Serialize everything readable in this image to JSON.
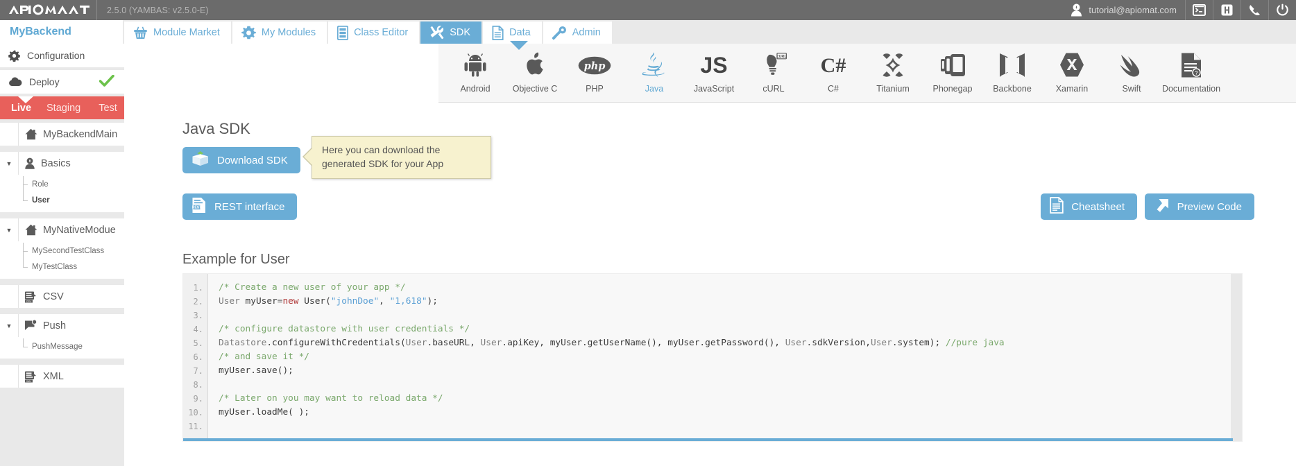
{
  "header": {
    "logo_text": "APIOMAT",
    "version": "2.5.0 (YAMBAS: v2.5.0-E)",
    "user_email": "tutorial@apiomat.com",
    "icons": [
      {
        "name": "terminal-icon"
      },
      {
        "name": "help-h-icon",
        "label": "H"
      },
      {
        "name": "phone-icon"
      },
      {
        "name": "power-icon"
      }
    ]
  },
  "tabs": {
    "backend_name": "MyBackend",
    "items": [
      {
        "label": "Module Market",
        "icon": "basket-icon",
        "active": false
      },
      {
        "label": "My Modules",
        "icon": "gear-icon",
        "active": false
      },
      {
        "label": "Class Editor",
        "icon": "class-editor-icon",
        "active": false
      },
      {
        "label": "SDK",
        "icon": "tools-icon",
        "active": true
      },
      {
        "label": "Data",
        "icon": "document-icon",
        "active": false
      },
      {
        "label": "Admin",
        "icon": "key-icon",
        "active": false
      }
    ]
  },
  "platforms": [
    {
      "label": "Android",
      "icon": "android-icon",
      "selected": false
    },
    {
      "label": "Objective C",
      "icon": "apple-icon",
      "selected": false
    },
    {
      "label": "PHP",
      "icon": "php-icon",
      "selected": false
    },
    {
      "label": "Java",
      "icon": "java-icon",
      "selected": true
    },
    {
      "label": "JavaScript",
      "icon": "js-icon",
      "selected": false
    },
    {
      "label": "cURL",
      "icon": "curl-bulb-icon",
      "selected": false
    },
    {
      "label": "C#",
      "icon": "csharp-icon",
      "selected": false
    },
    {
      "label": "Titanium",
      "icon": "titanium-icon",
      "selected": false
    },
    {
      "label": "Phonegap",
      "icon": "phonegap-icon",
      "selected": false
    },
    {
      "label": "Backbone",
      "icon": "backbone-icon",
      "selected": false
    },
    {
      "label": "Xamarin",
      "icon": "xamarin-icon",
      "selected": false
    },
    {
      "label": "Swift",
      "icon": "swift-icon",
      "selected": false
    },
    {
      "label": "Documentation",
      "icon": "documentation-icon",
      "selected": false
    }
  ],
  "sidebar": {
    "configuration": "Configuration",
    "deploy": "Deploy",
    "deploy_status": "✔",
    "environments": [
      {
        "label": "Live",
        "active": true
      },
      {
        "label": "Staging",
        "active": false
      },
      {
        "label": "Test",
        "active": false
      }
    ],
    "groups": [
      {
        "title": "MyBackendMain",
        "icon": "home-icon",
        "caret": false,
        "children": []
      },
      {
        "title": "Basics",
        "icon": "user-icon",
        "caret": true,
        "children": [
          {
            "label": "Role",
            "bold": false
          },
          {
            "label": "User",
            "bold": true
          }
        ]
      },
      {
        "title": "MyNativeModue",
        "icon": "home-icon",
        "caret": true,
        "children": [
          {
            "label": "MySecondTestClass",
            "bold": false
          },
          {
            "label": "MyTestClass",
            "bold": false
          }
        ]
      },
      {
        "title": "CSV",
        "icon": "csv-icon",
        "caret": false,
        "children": []
      },
      {
        "title": "Push",
        "icon": "push-icon",
        "caret": true,
        "children": [
          {
            "label": "PushMessage",
            "bold": false
          }
        ]
      },
      {
        "title": "XML",
        "icon": "xml-icon",
        "caret": false,
        "children": []
      }
    ]
  },
  "main": {
    "page_title": "Java SDK",
    "download_button": "Download SDK",
    "rest_button": "REST interface",
    "cheatsheet_button": "Cheatsheet",
    "preview_button": "Preview Code",
    "tooltip_line1": "Here you can download the",
    "tooltip_line2": "generated SDK for your App",
    "example_title": "Example for User",
    "code": {
      "line_numbers": [
        "1.",
        "2.",
        "3.",
        "4.",
        "5.",
        "6.",
        "7.",
        "8.",
        "9.",
        "10.",
        "11."
      ],
      "lines": [
        "/* Create a new user of your app */",
        "User myUser=new User(\"johnDoe\", \"1,618\");",
        "",
        "/* configure datastore with user credentials */",
        "Datastore.configureWithCredentials(User.baseURL, User.apiKey, myUser.getUserName(), myUser.getPassword(), User.sdkVersion,User.system); //pure java",
        "/* and save it */",
        "myUser.save();",
        "",
        "/* Later on you may want to reload data */",
        "myUser.loadMe( );",
        ""
      ]
    }
  },
  "colors": {
    "accent": "#6aadd6",
    "header_bg": "#6b6b6b",
    "env_bar": "#e8605b",
    "tooltip_bg": "#f7f2cf",
    "comment_green": "#7aa86c",
    "keyword_red": "#b03a3a",
    "string_blue": "#5a9fd4"
  }
}
